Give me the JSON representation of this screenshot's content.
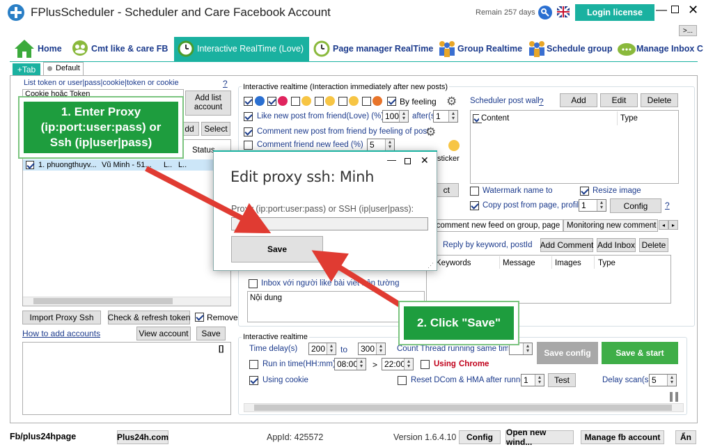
{
  "window": {
    "title": "FPlusScheduler - Scheduler and Care Facebook Account",
    "remain": "Remain 257 days",
    "login_label": "Login license",
    "more": ">..."
  },
  "nav": {
    "tabs": [
      {
        "label": "Home"
      },
      {
        "label": "Cmt like & care FB"
      },
      {
        "label": "Interactive RealTime (Love)"
      },
      {
        "label": "Page manager RealTime"
      },
      {
        "label": "Group Realtime"
      },
      {
        "label": "Schedule group"
      },
      {
        "label": "Manage Inbox C"
      }
    ]
  },
  "subtabs": {
    "add": "+Tab",
    "default": "Default"
  },
  "left": {
    "list_label": "List token or user|pass|cookie|token or cookie",
    "help": "?",
    "textarea_value": "Cookie hoặc Token",
    "add_list": "Add list account",
    "add_btn": "dd",
    "select_btn": "Select",
    "status_header": "Status",
    "row": {
      "name": "1. phuongthuyv...",
      "account": "Vũ Minh - 51...",
      "c1": "L..",
      "c2": "L.."
    },
    "import_proxy": "Import Proxy Ssh",
    "check_token": "Check & refresh token",
    "remove": "Remove",
    "how_to": "How to add accounts",
    "view_account": "View account",
    "save": "Save",
    "log_btn": "[]"
  },
  "middle": {
    "group_title": "Interactive realtime (Interaction immediately after new posts)",
    "by_feeling": "By feeling",
    "like_new_post": "Like new post from friend(Love) (%)",
    "like_pct": "100",
    "after": "after(s)",
    "after_val": "1",
    "comment_feeling": "Comment new post from friend by feeling of post",
    "comment_feed": "Comment friend new feed (%)",
    "comment_pct": "5",
    "sticker": "sticker",
    "ct": "ct",
    "inbox_like": "Inbox với người like bài viết trên tường",
    "content_placeholder": "Nội dung"
  },
  "right": {
    "scheduler_label": "Scheduler post wall",
    "help": "?",
    "add": "Add",
    "edit": "Edit",
    "delete": "Delete",
    "col_content": "Content",
    "col_type": "Type",
    "watermark": "Watermark name to",
    "resize": "Resize image",
    "copy_post": "Copy post from page, profile,",
    "copy_val": "1",
    "config": "Config",
    "tab1": "d comment new feed on group, page",
    "tab2": "Monitoring new comment or",
    "reply_keyword": "Reply by keyword, postId",
    "add_comment": "Add Comment",
    "add_inbox": "Add Inbox",
    "delete2": "Delete",
    "col_keywords": "Keywords",
    "col_message": "Message",
    "col_images": "Images",
    "col_type2": "Type"
  },
  "bottom": {
    "group_title": "Interactive realtime",
    "time_delay": "Time delay(s)",
    "delay_from": "200",
    "to": "to",
    "delay_to": "300",
    "count_thread": "Count Thread running same time",
    "run_in_time": "Run in time(HH:mm)",
    "time_from": "08:00",
    "gt": ">",
    "time_to": "22:00",
    "using": "Using",
    "chrome": "Chrome",
    "using_cookie": "Using cookie",
    "reset_dcom": "Reset DCom & HMA after runned",
    "reset_val": "1",
    "test": "Test",
    "delay_scan": "Delay scan(s)",
    "delay_scan_val": "5",
    "save_config": "Save config",
    "save_start": "Save & start"
  },
  "dialog": {
    "title": "Edit proxy ssh: Minh",
    "field_label": "Proxy (ip:port:user:pass) or SSH (ip|user|pass):",
    "field_value": "",
    "save": "Save"
  },
  "callouts": {
    "c1": "1. Enter Proxy (ip:port:user:pass) or Ssh (ip|user|pass)",
    "c2": "2. Click \"Save\""
  },
  "statusbar": {
    "fb": "Fb/plus24hpage",
    "site": "Plus24h.com",
    "appid": "AppId: 425572",
    "version": "Version 1.6.4.10",
    "config": "Config",
    "open_window": "Open new wind...",
    "manage_account": "Manage fb account",
    "lang": "Ẩn"
  }
}
